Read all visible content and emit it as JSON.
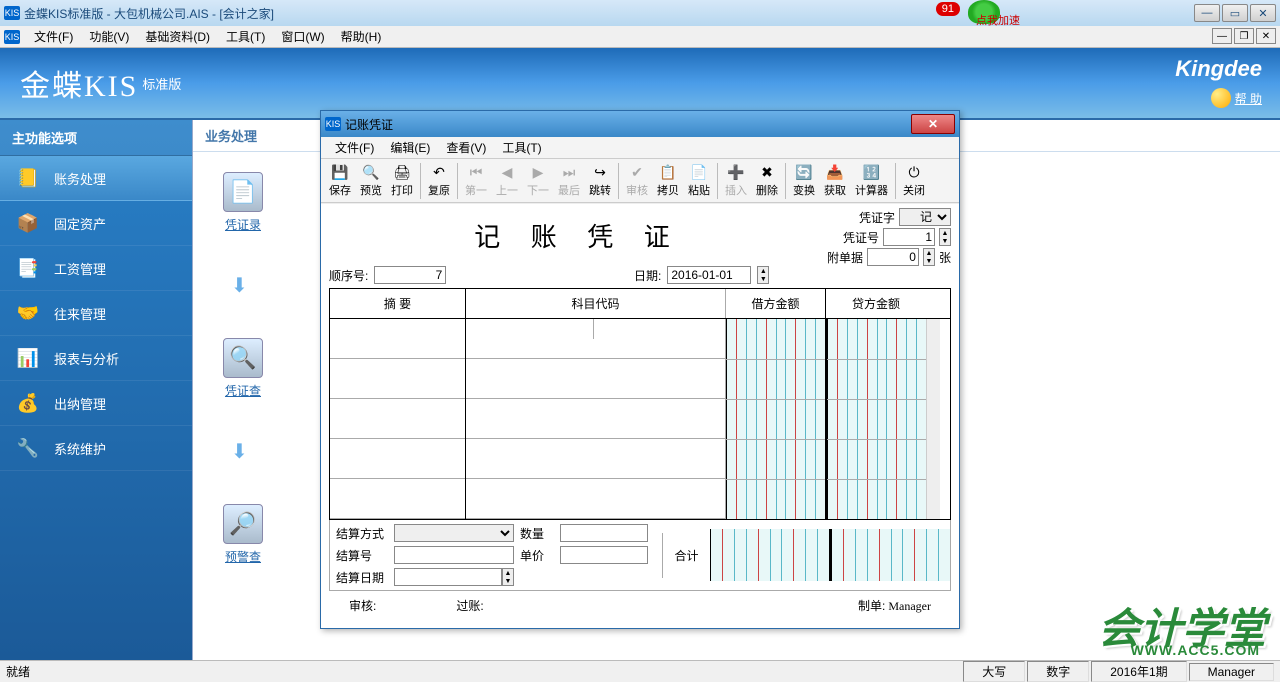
{
  "app_title": "金蝶KIS标准版 - 大包机械公司.AIS - [会计之家]",
  "badge_count": "91",
  "badge_label": "点我加速",
  "kis_icon": "KIS",
  "main_menu": [
    "文件(F)",
    "功能(V)",
    "基础资料(D)",
    "工具(T)",
    "窗口(W)",
    "帮助(H)"
  ],
  "header": {
    "logo": "金蝶KIS",
    "logo_sub": "标准版",
    "brand": "Kingdee",
    "help": "帮 助"
  },
  "sidebar": {
    "title": "主功能选项",
    "items": [
      {
        "icon": "📒",
        "label": "账务处理"
      },
      {
        "icon": "📦",
        "label": "固定资产"
      },
      {
        "icon": "📑",
        "label": "工资管理"
      },
      {
        "icon": "🤝",
        "label": "往来管理"
      },
      {
        "icon": "📊",
        "label": "报表与分析"
      },
      {
        "icon": "💰",
        "label": "出纳管理"
      },
      {
        "icon": "🔧",
        "label": "系统维护"
      }
    ]
  },
  "content": {
    "title": "业务处理",
    "items": [
      {
        "icon": "📄",
        "label": "凭证录"
      },
      {
        "icon": "🔍",
        "label": "凭证查"
      },
      {
        "icon": "🔎",
        "label": "预警查"
      }
    ]
  },
  "dialog": {
    "title": "记账凭证",
    "menu": [
      "文件(F)",
      "编辑(E)",
      "查看(V)",
      "工具(T)"
    ],
    "toolbar": [
      {
        "icon": "💾",
        "label": "保存"
      },
      {
        "icon": "🔍",
        "label": "预览"
      },
      {
        "icon": "🖨",
        "label": "打印"
      },
      {
        "sep": true
      },
      {
        "icon": "↶",
        "label": "复原"
      },
      {
        "sep": true
      },
      {
        "icon": "⏮",
        "label": "第一",
        "disabled": true
      },
      {
        "icon": "◀",
        "label": "上一",
        "disabled": true
      },
      {
        "icon": "▶",
        "label": "下一",
        "disabled": true
      },
      {
        "icon": "⏭",
        "label": "最后",
        "disabled": true
      },
      {
        "icon": "↪",
        "label": "跳转"
      },
      {
        "sep": true
      },
      {
        "icon": "✔",
        "label": "审核",
        "disabled": true
      },
      {
        "icon": "📋",
        "label": "拷贝"
      },
      {
        "icon": "📄",
        "label": "粘贴"
      },
      {
        "sep": true
      },
      {
        "icon": "➕",
        "label": "插入",
        "disabled": true
      },
      {
        "icon": "✖",
        "label": "删除"
      },
      {
        "sep": true
      },
      {
        "icon": "🔄",
        "label": "变换"
      },
      {
        "icon": "📥",
        "label": "获取"
      },
      {
        "icon": "🔢",
        "label": "计算器"
      },
      {
        "sep": true
      },
      {
        "icon": "⏻",
        "label": "关闭"
      }
    ],
    "voucher_title": "记 账 凭 证",
    "voucher_word_label": "凭证字",
    "voucher_word": "记",
    "voucher_no_label": "凭证号",
    "voucher_no": "1",
    "attach_label": "附单据",
    "attach_val": "0",
    "attach_unit": "张",
    "seq_label": "顺序号:",
    "seq_val": "7",
    "date_label": "日期:",
    "date_val": "2016-01-01",
    "table_head": {
      "summary": "摘    要",
      "subject": "科目代码",
      "debit": "借方金额",
      "credit": "贷方金额"
    },
    "footer": {
      "settle_method": "结算方式",
      "qty": "数量",
      "settle_no": "结算号",
      "price": "单价",
      "settle_date": "结算日期",
      "heji": "合计"
    },
    "sig": {
      "audit": "审核:",
      "post": "过账:",
      "make": "制单:",
      "maker": "Manager"
    }
  },
  "status": {
    "left": "就绪",
    "caps": "大写",
    "num": "数字",
    "period": "2016年1期",
    "user": "Manager"
  },
  "watermark": {
    "main": "会计学堂",
    "sub": "WWW.ACC5.COM"
  }
}
